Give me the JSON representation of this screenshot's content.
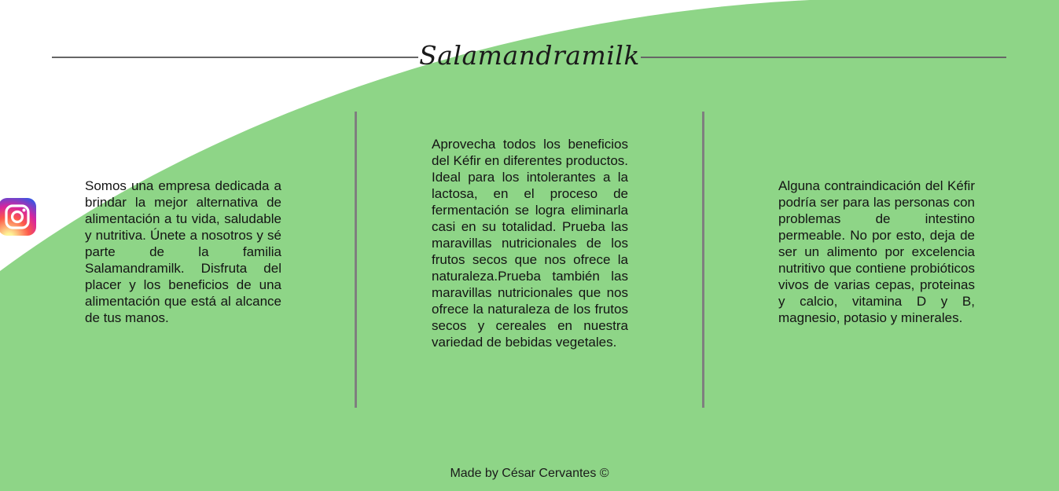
{
  "brand": {
    "title": "Salamandramilk"
  },
  "colors": {
    "wave_green": "#8ed587",
    "divider_gray": "#7f7f7f"
  },
  "social": {
    "icon": "instagram-icon"
  },
  "columns": [
    {
      "text": "Somos una empresa dedicada a brindar la mejor alternativa de alimentación a tu vida, saludable y nutritiva. Únete a nosotros y sé parte de la familia Salamandramilk. Disfruta del placer y los beneficios de una alimentación que está al alcance de tus manos."
    },
    {
      "text": "Aprovecha todos los beneficios del Kéfir en diferentes productos. Ideal para los intolerantes a la lactosa, en el proceso de fermentación se logra eliminarla casi en su totalidad. Prueba las maravillas nutricionales de los frutos secos que nos ofrece la naturaleza.Prueba también las maravillas nutricionales que nos ofrece la naturaleza de los frutos secos y cereales en nuestra variedad de bebidas vegetales."
    },
    {
      "text": "Alguna contraindicación del Kéfir podría ser para las personas con problemas de intestino permeable. No por esto, deja de ser un alimento por excelencia nutritivo que contiene probióticos vivos de varias cepas, proteinas y calcio, vitamina D y B, magnesio, potasio y minerales."
    }
  ],
  "footer": {
    "credit": "Made by César Cervantes ©"
  }
}
